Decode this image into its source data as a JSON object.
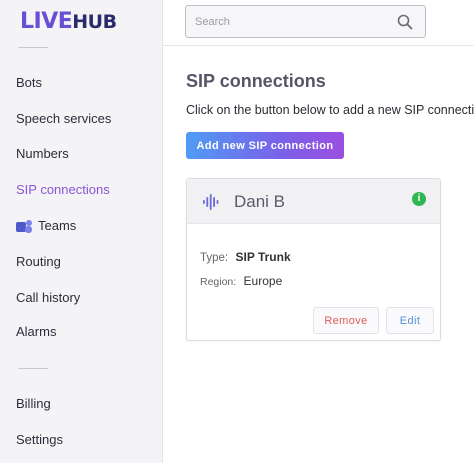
{
  "brand": {
    "logo_prefix": "LIVE",
    "logo_suffix": "HUB"
  },
  "sidebar": {
    "items": [
      {
        "label": "Bots"
      },
      {
        "label": "Speech services"
      },
      {
        "label": "Numbers"
      },
      {
        "label": "SIP connections",
        "active": true
      },
      {
        "label": "Teams",
        "icon": "microsoft-teams-icon"
      },
      {
        "label": "Routing"
      },
      {
        "label": "Call history"
      },
      {
        "label": "Alarms"
      }
    ],
    "bottom_items": [
      {
        "label": "Billing"
      },
      {
        "label": "Settings"
      }
    ]
  },
  "search": {
    "placeholder": "Search",
    "value": ""
  },
  "main": {
    "title": "SIP connections",
    "description": "Click on the button below to add a new SIP connection.",
    "add_button_label": "Add new SIP connection"
  },
  "connection_card": {
    "name": "Dani B",
    "icon": "sound-wave-icon",
    "status_icon": "info-icon",
    "type_label": "Type:",
    "type_value": "SIP Trunk",
    "region_label": "Region:",
    "region_value": "Europe",
    "remove_label": "Remove",
    "edit_label": "Edit"
  },
  "colors": {
    "accent_purple": "#8a55d6",
    "button_gradient_start": "#4f9cf5",
    "button_gradient_end": "#9b4fe0",
    "status_green": "#2fb551",
    "remove_red": "#e05a5a",
    "edit_blue": "#5a8fd8"
  }
}
